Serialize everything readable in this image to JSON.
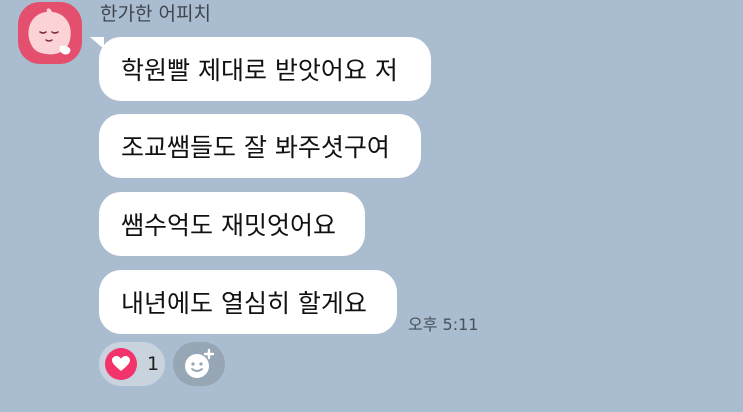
{
  "sender": {
    "name": "한가한 어피치",
    "avatar_icon": "apeach-profile-icon",
    "avatar_color": "#e34f6d"
  },
  "messages": [
    {
      "text": "학원빨 제대로 받앗어요 저"
    },
    {
      "text": "조교쌤들도 잘 봐주셧구여"
    },
    {
      "text": "쌤수억도 재밋엇어요"
    },
    {
      "text": "내년에도 열심히 할게요"
    }
  ],
  "timestamp": "오후 5:11",
  "reactions": {
    "heart": {
      "icon": "heart-icon",
      "count": "1",
      "color": "#f2346a"
    },
    "add_reaction_icon": "add-reaction-icon"
  },
  "theme": {
    "background": "#aabccf",
    "bubble": "#ffffff"
  }
}
